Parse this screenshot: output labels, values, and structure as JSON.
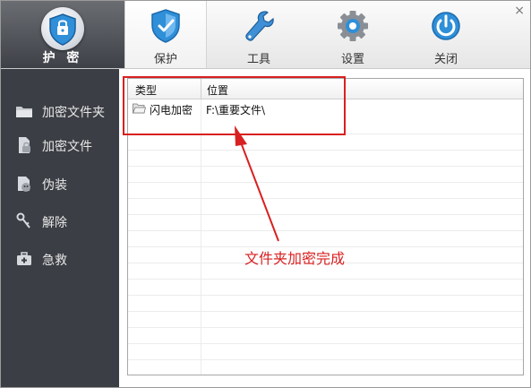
{
  "app": {
    "logo_text": "护 密"
  },
  "toolbar": {
    "tabs": [
      {
        "label": "保护",
        "icon": "shield-check-icon",
        "active": true
      },
      {
        "label": "工具",
        "icon": "wrench-icon",
        "active": false
      },
      {
        "label": "设置",
        "icon": "gear-icon",
        "active": false
      },
      {
        "label": "关闭",
        "icon": "power-icon",
        "active": false
      }
    ],
    "close_glyph": "×"
  },
  "sidebar": {
    "items": [
      {
        "label": "加密文件夹",
        "icon": "folder-icon"
      },
      {
        "label": "加密文件",
        "icon": "document-icon"
      },
      {
        "label": "伪装",
        "icon": "mask-icon"
      },
      {
        "label": "解除",
        "icon": "key-icon"
      },
      {
        "label": "急救",
        "icon": "first-aid-kit-icon"
      }
    ]
  },
  "table": {
    "columns": [
      "类型",
      "位置"
    ],
    "rows": [
      {
        "type": "闪电加密",
        "location": "F:\\重要文件\\",
        "icon": "folder-open-icon"
      }
    ]
  },
  "annotation": {
    "text": "文件夹加密完成",
    "color": "#d92020"
  },
  "colors": {
    "sidebar_bg": "#3b3e44",
    "accent_blue": "#2f8fd8",
    "highlight_red": "#d92020"
  }
}
